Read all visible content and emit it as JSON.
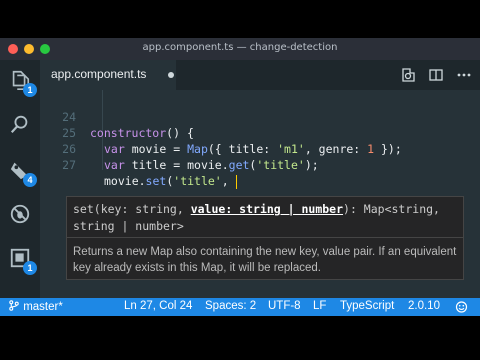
{
  "window": {
    "title": "app.component.ts — change-detection"
  },
  "activity_bar": {
    "items": [
      {
        "icon": "files-icon",
        "badge": "1"
      },
      {
        "icon": "search-icon",
        "badge": ""
      },
      {
        "icon": "source-control-icon",
        "badge": "4"
      },
      {
        "icon": "debug-icon",
        "badge": ""
      },
      {
        "icon": "extensions-icon",
        "badge": "1"
      }
    ]
  },
  "tabs": [
    {
      "label": "app.component.ts",
      "modified": true
    }
  ],
  "toolbar": {
    "icons": [
      "open-changes-icon",
      "split-editor-icon",
      "more-icon"
    ]
  },
  "editor": {
    "lines": [
      {
        "num": "24"
      },
      {
        "num": "25"
      },
      {
        "num": "26"
      },
      {
        "num": "27"
      }
    ],
    "code": {
      "l24_kw": "constructor",
      "l24_rest": "() {",
      "l25_var": "var",
      "l25_name": " movie = ",
      "l25_fn": "Map",
      "l25_open": "({ title: ",
      "l25_str": "'m1'",
      "l25_mid": ", genre: ",
      "l25_num": "1",
      "l25_close": " });",
      "l26_var": "var",
      "l26_name": " title = movie.",
      "l26_fn": "get",
      "l26_open": "(",
      "l26_str": "'title'",
      "l26_close": ");",
      "l27_obj": "movie.",
      "l27_fn": "set",
      "l27_open": "(",
      "l27_str": "'title'",
      "l27_close": ", "
    }
  },
  "signature_help": {
    "sig_pre": "set(key: string, ",
    "sig_active": "value: string | number",
    "sig_post": "): Map<string, string | number>",
    "doc": "Returns a new Map also containing the new key, value pair. If an equivalent key already exists in this Map, it will be replaced."
  },
  "statusbar": {
    "branch": "master*",
    "position": "Ln 27, Col 24",
    "spaces": "Spaces: 2",
    "encoding": "UTF-8",
    "eol": "LF",
    "language": "TypeScript",
    "version": "2.0.10"
  },
  "colors": {
    "statusbar": "#1e88e5",
    "editor_bg": "#263238",
    "badge": "#1e88e5"
  }
}
